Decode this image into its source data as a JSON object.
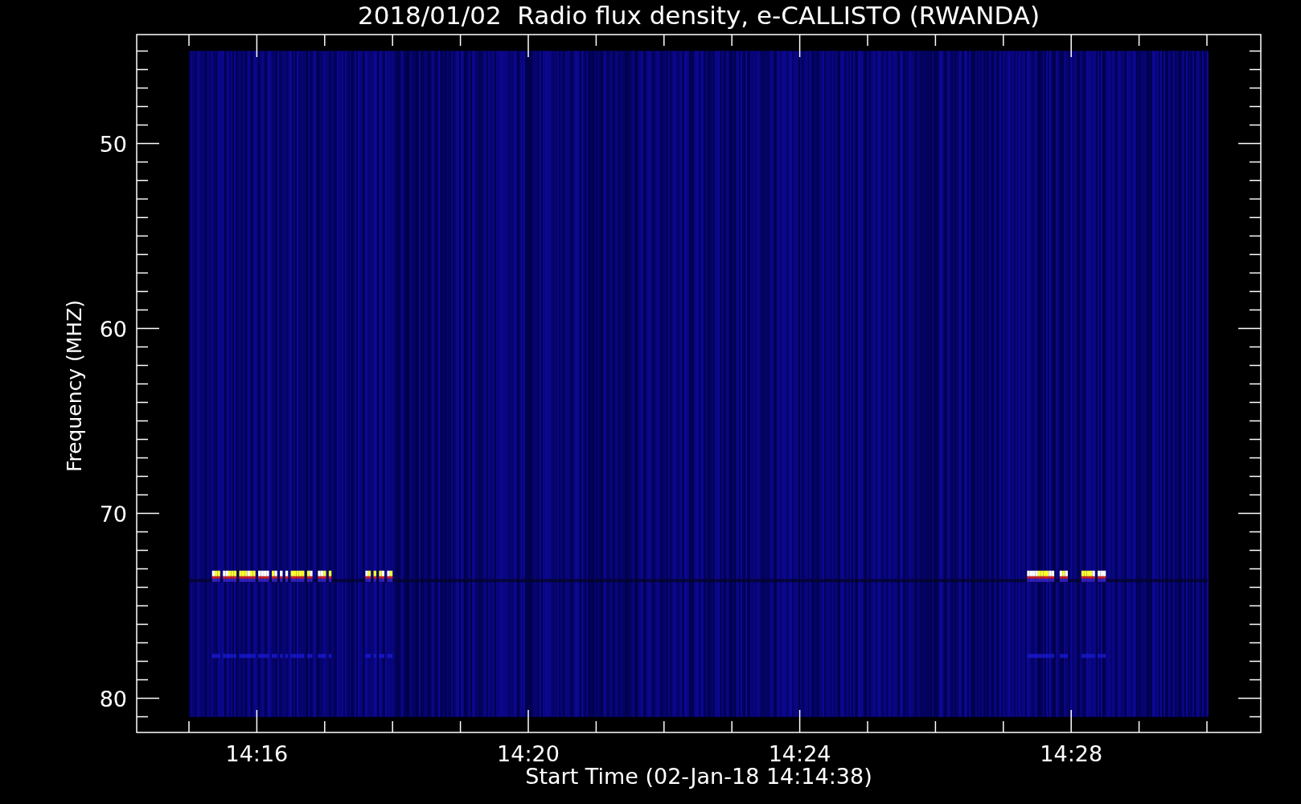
{
  "title": "2018/01/02  Radio flux density, e-CALLISTO (RWANDA)",
  "ylabel": "Frequency (MHZ)",
  "xlabel": "Start Time (02-Jan-18 14:14:38)",
  "yticks": [
    "50",
    "60",
    "70",
    "80"
  ],
  "xticks": [
    "14:16",
    "14:20",
    "14:24",
    "14:28"
  ]
}
